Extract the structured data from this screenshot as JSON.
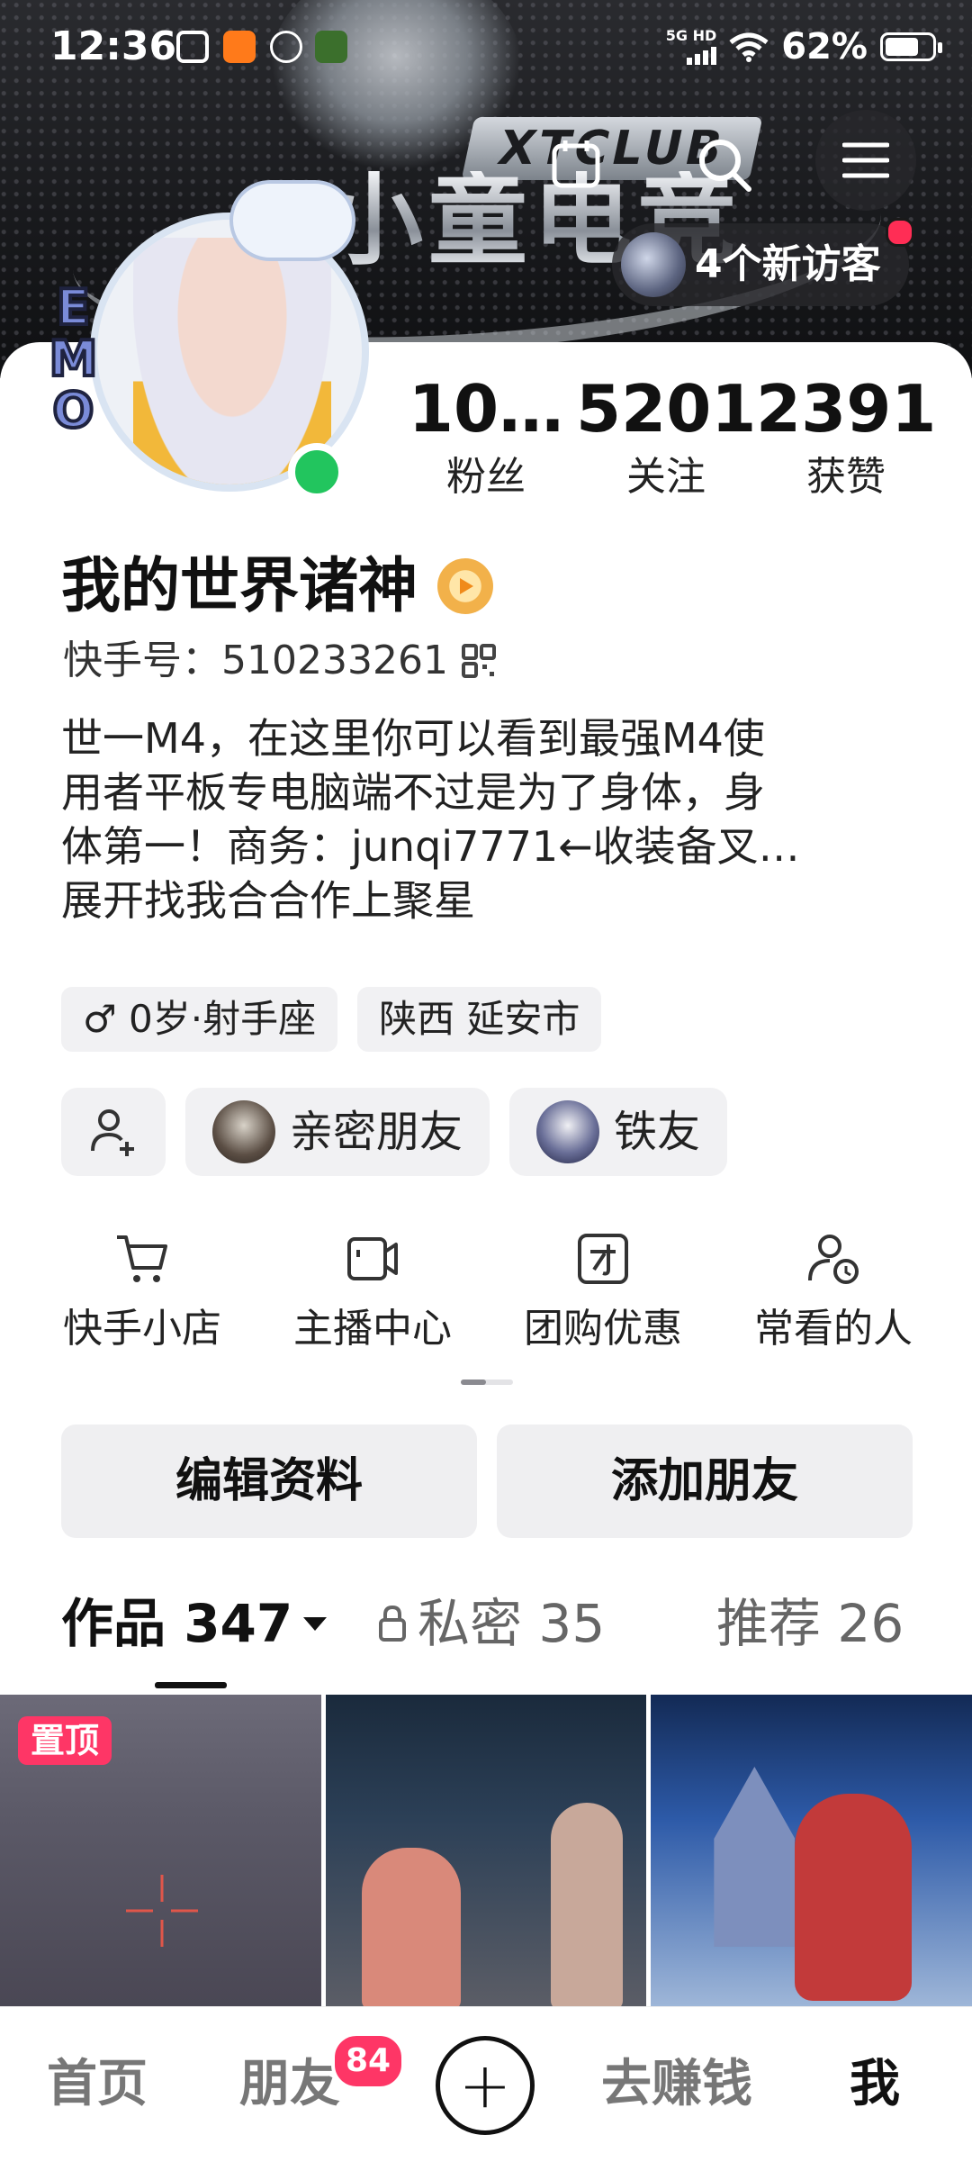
{
  "status_bar": {
    "time": "12:36",
    "network": "5G HD",
    "battery": "62%"
  },
  "header": {
    "visitor_label": "4个新访客",
    "banner_text": "小童电竞",
    "club_text": "XTCLUB"
  },
  "profile": {
    "stats": [
      {
        "value": "10…",
        "label": "粉丝"
      },
      {
        "value": "5201",
        "label": "关注"
      },
      {
        "value": "2391",
        "label": "获赞"
      }
    ],
    "avatar_sticker": "EMO",
    "name": "我的世界诸神",
    "kuaishou_id": "快手号：510233261",
    "bio": "世一M4，在这里你可以看到最强M4使\n用者平板专电脑端不过是为了身体，身\n体第一！商务：junqi7771←收装备叉…\n展开找我合合作上聚星",
    "tags": [
      "♂ 0岁·射手座",
      "陕西 延安市"
    ],
    "friends": [
      "亲密朋友",
      "铁友"
    ]
  },
  "tools": [
    {
      "icon": "cart-icon",
      "label": "快手小店"
    },
    {
      "icon": "camera-icon",
      "label": "主播中心"
    },
    {
      "icon": "group-buy-icon",
      "label": "团购优惠"
    },
    {
      "icon": "frequent-person-icon",
      "label": "常看的人"
    }
  ],
  "actions": {
    "edit": "编辑资料",
    "add_friend": "添加朋友"
  },
  "tabs": {
    "works": "作品 347",
    "private": "私密 35",
    "recommend": "推荐 26"
  },
  "grid": {
    "pinned_label": "置顶"
  },
  "bottom_nav": {
    "home": "首页",
    "friends": "朋友",
    "friends_badge": "84",
    "earn": "去赚钱",
    "me": "我"
  },
  "colors": {
    "accent": "#fe3666",
    "online": "#22c55e"
  }
}
